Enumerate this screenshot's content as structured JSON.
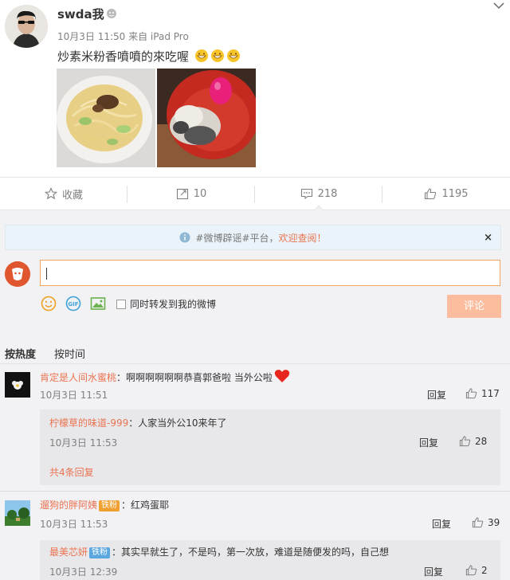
{
  "post": {
    "username": "swda我",
    "meta": "10月3日 11:50 来自 iPad Pro",
    "text": "炒素米粉香噴噴的來吃喔"
  },
  "actions": {
    "favorite": "收藏",
    "repost": "10",
    "comment": "218",
    "like": "1195"
  },
  "notice": {
    "prefix": "#微博辟谣#平台，",
    "link": "欢迎查阅！",
    "close": "×"
  },
  "composer": {
    "checkbox_label": "同时转发到我的微博",
    "submit": "评论"
  },
  "sort": {
    "hot": "按热度",
    "time": "按时间"
  },
  "comments": [
    {
      "user": "肯定是人间水蜜桃",
      "text": "：啊啊啊啊啊啊恭喜郭爸啦 当外公啦",
      "time": "10月3日 11:51",
      "reply": "回复",
      "likes": "117",
      "sub": {
        "user": "柠檬草的味道-999",
        "text": "：人家当外公10来年了",
        "time": "10月3日 11:53",
        "reply": "回复",
        "likes": "28"
      },
      "more": "共4条回复"
    },
    {
      "user": "遛狗的胖阿姨",
      "badge": "铁粉",
      "text": "：红鸡蛋耶",
      "time": "10月3日 11:53",
      "reply": "回复",
      "likes": "39",
      "sub": {
        "user": "最美芯妍",
        "badge": "铁粉",
        "text": "：其实早就生了，不是吗，第一次放，难道是随便发的吗，自己想",
        "time": "10月3日 12:39",
        "reply": "回复",
        "likes": "2"
      }
    }
  ],
  "colors": {
    "accent": "#eb7350",
    "submit_disabled": "#fbbd9e",
    "input_border": "#f1a45a",
    "comment_bg": "#f2f2f5",
    "notice_bg": "#eaf3f9"
  }
}
